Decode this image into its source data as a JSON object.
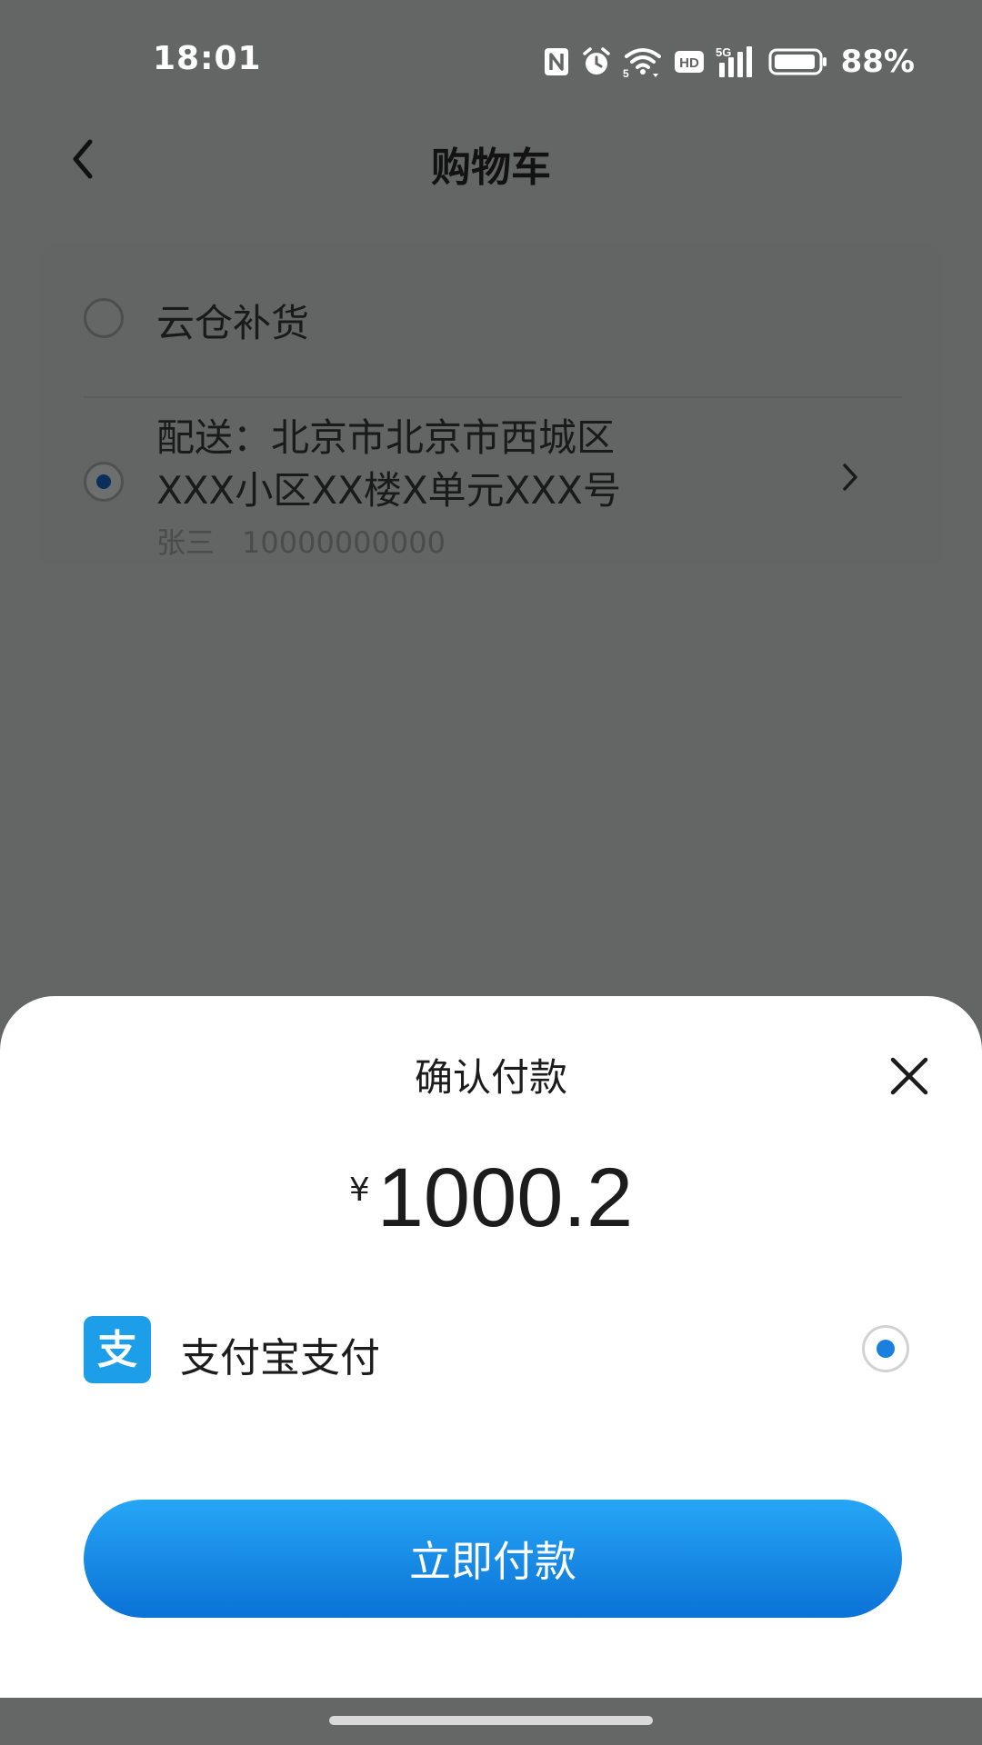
{
  "status_bar": {
    "time": "18:01",
    "battery_percent": "88%",
    "icons": [
      "nfc-icon",
      "alarm-icon",
      "wifi-icon",
      "hd-icon",
      "signal-5g-icon",
      "battery-icon"
    ],
    "hd_label": "HD",
    "network_label": "5G",
    "wifi_band": "5"
  },
  "nav": {
    "title": "购物车",
    "back_icon": "chevron-left-icon"
  },
  "address_card": {
    "pickup_option": {
      "label": "云仓补货",
      "selected": false
    },
    "delivery_option": {
      "line1": "配送：北京市北京市西城区",
      "line2": "XXX小区XX楼X单元XXX号",
      "name": "张三",
      "phone": "10000000000",
      "selected": true
    }
  },
  "payment_sheet": {
    "title": "确认付款",
    "currency_symbol": "¥",
    "amount": "1000.2",
    "method": {
      "label": "支付宝支付",
      "icon": "alipay-icon",
      "icon_glyph": "支",
      "selected": true
    },
    "pay_button_label": "立即付款",
    "close_icon": "close-icon"
  },
  "colors": {
    "overlay": "#646565",
    "primary_blue": "#1b7fe0",
    "button_gradient_top": "#26a6f6",
    "button_gradient_bottom": "#0b72d6",
    "alipay_blue": "#1c9fe8"
  }
}
